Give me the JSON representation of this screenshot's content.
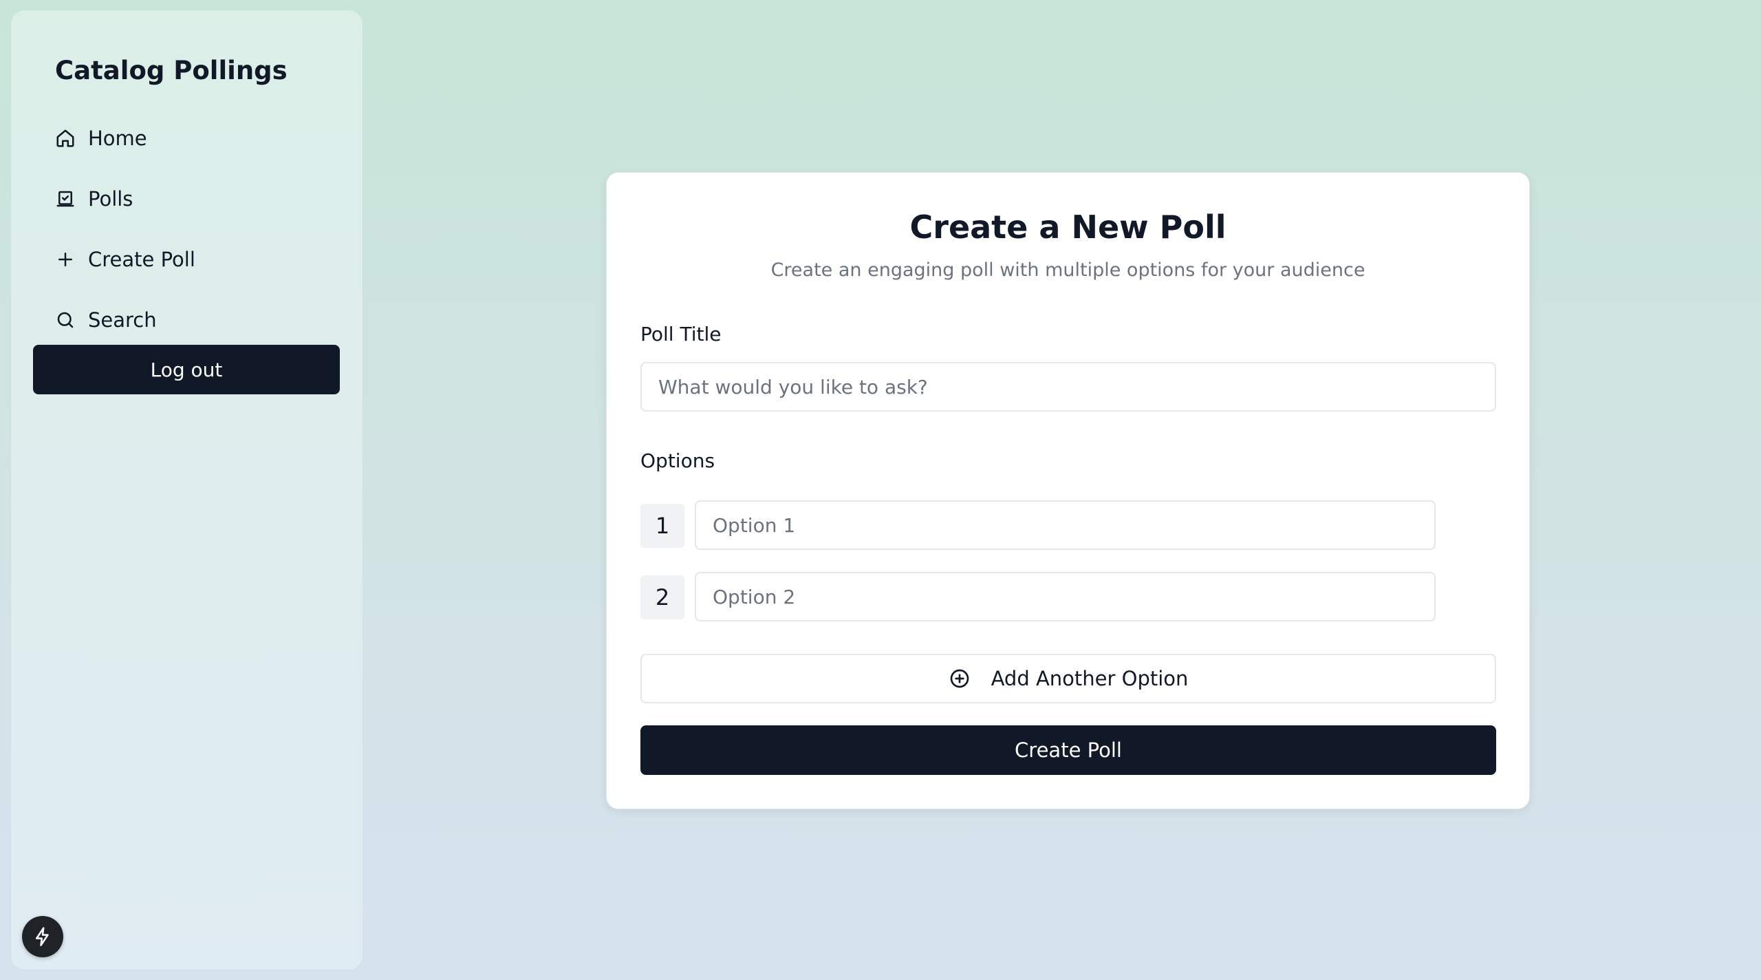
{
  "app": {
    "title": "Catalog Pollings"
  },
  "sidebar": {
    "items": [
      {
        "label": "Home",
        "icon": "home-icon"
      },
      {
        "label": "Polls",
        "icon": "poll-box-icon"
      },
      {
        "label": "Create Poll",
        "icon": "plus-icon"
      },
      {
        "label": "Search",
        "icon": "search-icon"
      }
    ],
    "logout_label": "Log out",
    "floating_button_icon": "lightning-bolt-icon"
  },
  "form": {
    "title": "Create a New Poll",
    "subtitle": "Create an engaging poll with multiple options for your audience",
    "poll_title_label": "Poll Title",
    "poll_title_value": "",
    "poll_title_placeholder": "What would you like to ask?",
    "options_label": "Options",
    "options": [
      {
        "number": "1",
        "value": "",
        "placeholder": "Option 1"
      },
      {
        "number": "2",
        "value": "",
        "placeholder": "Option 2"
      }
    ],
    "add_option_label": "Add Another Option",
    "add_option_icon": "plus-circle-icon",
    "submit_label": "Create Poll"
  },
  "colors": {
    "primary": "#111827",
    "muted_text": "#6b7280",
    "border": "#e5e7eb",
    "background_top": "#c7e5d8",
    "background_bottom": "#d6e3ef"
  }
}
